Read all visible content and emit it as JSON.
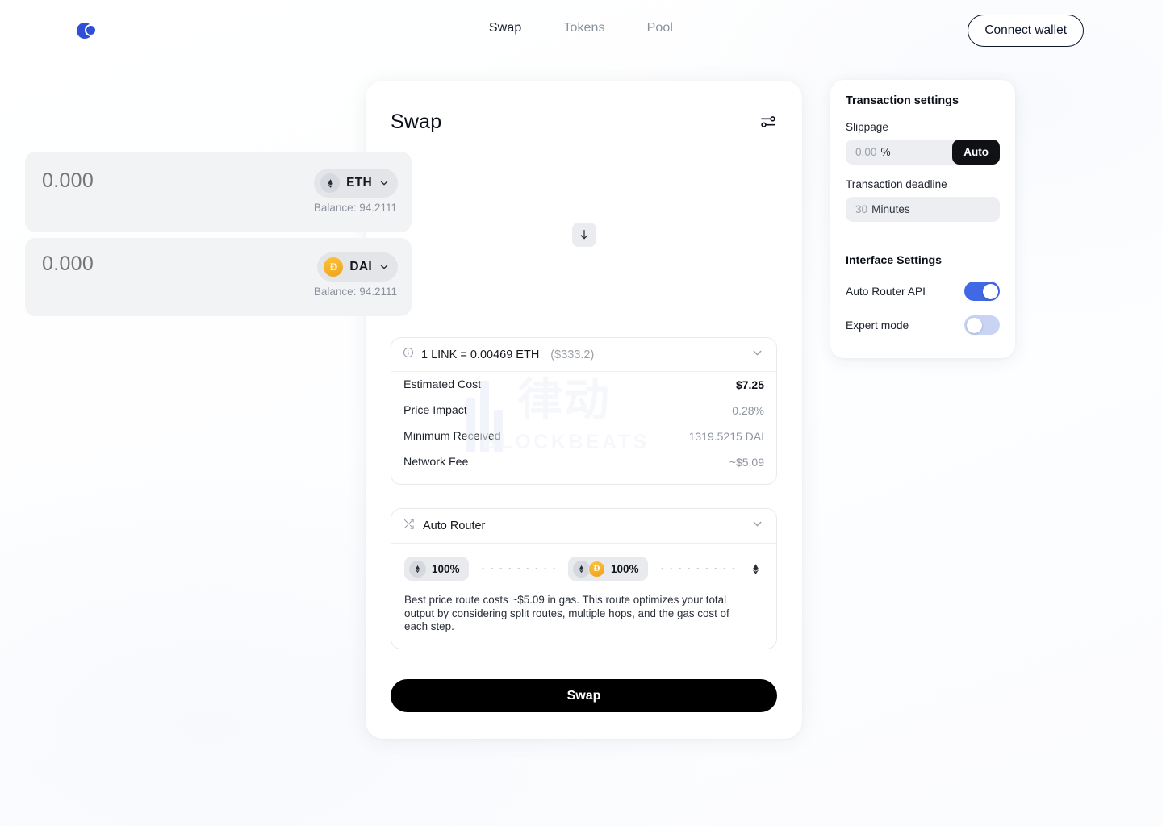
{
  "header": {
    "logo_icon": "two-circles-logo",
    "nav": [
      {
        "label": "Swap",
        "active": true
      },
      {
        "label": "Tokens",
        "active": false
      },
      {
        "label": "Pool",
        "active": false
      }
    ],
    "connect_wallet_label": "Connect wallet"
  },
  "swap": {
    "title": "Swap",
    "settings_icon": "tune-sliders-icon",
    "swap_direction_icon": "arrow-down-icon",
    "from": {
      "amount_placeholder": "0.000",
      "amount_value": "",
      "token_symbol": "ETH",
      "token_icon": "ethereum-icon",
      "balance_label": "Balance: 94.2111"
    },
    "to": {
      "amount_placeholder": "0.000",
      "amount_value": "",
      "token_symbol": "DAI",
      "token_icon": "dai-icon",
      "balance_label": "Balance: 94.2111"
    },
    "rate": {
      "info_icon": "info-circle-icon",
      "text": "1 LINK = 0.00469 ETH",
      "usd": "($333.2)",
      "chevron_icon": "chevron-down-icon"
    },
    "details": [
      {
        "label": "Estimated Cost",
        "value": "$7.25",
        "emphasis": true
      },
      {
        "label": "Price Impact",
        "value": "0.28%",
        "emphasis": false
      },
      {
        "label": "Minimum Received",
        "value": "1319.5215 DAI",
        "emphasis": false
      },
      {
        "label": "Network Fee",
        "value": "~$5.09",
        "emphasis": false
      }
    ],
    "router": {
      "icon": "shuffle-icon",
      "title": "Auto Router",
      "chevron_icon": "chevron-down-icon",
      "hops": [
        {
          "percent": "100%",
          "icons": [
            "ethereum-icon"
          ]
        },
        {
          "percent": "100%",
          "icons": [
            "ethereum-icon",
            "dai-icon"
          ]
        }
      ],
      "end_icon": "ethereum-icon",
      "note": "Best price route costs ~$5.09 in gas. This route optimizes your total output by considering split routes, multiple hops, and the gas cost of each step."
    },
    "submit_label": "Swap"
  },
  "settings_panel": {
    "title": "Transaction settings",
    "slippage": {
      "label": "Slippage",
      "value": "",
      "placeholder": "0.00",
      "unit": "%",
      "auto_label": "Auto"
    },
    "deadline": {
      "label": "Transaction deadline",
      "value": "",
      "placeholder": "30",
      "unit": "Minutes"
    },
    "interface": {
      "title": "Interface Settings",
      "toggles": [
        {
          "label": "Auto Router API",
          "on": true
        },
        {
          "label": "Expert mode",
          "on": false
        }
      ]
    }
  },
  "watermark": {
    "cn": "律动",
    "en": "BLOCKBEATS"
  },
  "colors": {
    "accent_blue": "#4169e6",
    "logo_blue": "#2f4fd4",
    "dai_orange": "#f0a31c",
    "primary_button": "#000000",
    "panel_gray": "#f2f3f5"
  }
}
